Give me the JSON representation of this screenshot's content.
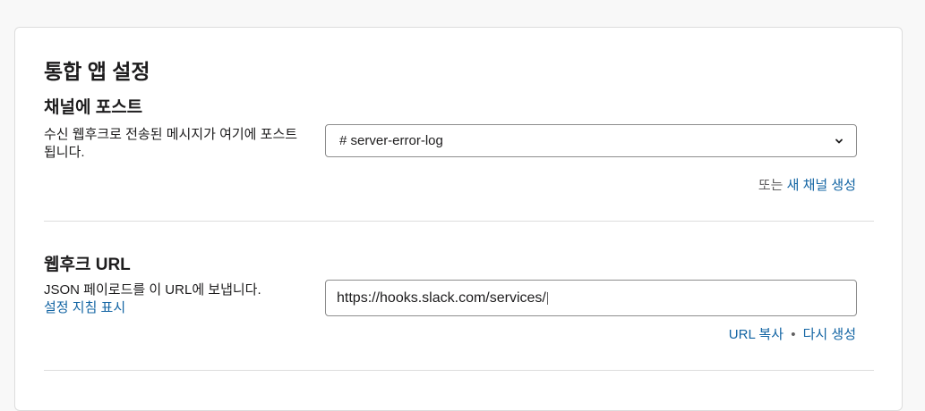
{
  "settings": {
    "title": "통합 앱 설정",
    "post_to_channel": {
      "heading": "채널에 포스트",
      "description": "수신 웹후크로 전송된 메시지가 여기에 포스트됩니다.",
      "selected_channel": "# server-error-log",
      "alt_prefix": "또는",
      "create_channel_link": "새 채널 생성"
    },
    "webhook_url": {
      "heading": "웹후크 URL",
      "description": "JSON 페이로드를 이 URL에 보냅니다.",
      "instructions_link": "설정 지침 표시",
      "url_value": "https://hooks.slack.com/services/",
      "copy_link": "URL 복사",
      "separator": "•",
      "regenerate_link": "다시 생성"
    }
  },
  "colors": {
    "link": "#1264a3",
    "text": "#1d1c1d",
    "muted": "#616061",
    "border": "#dddddd"
  }
}
